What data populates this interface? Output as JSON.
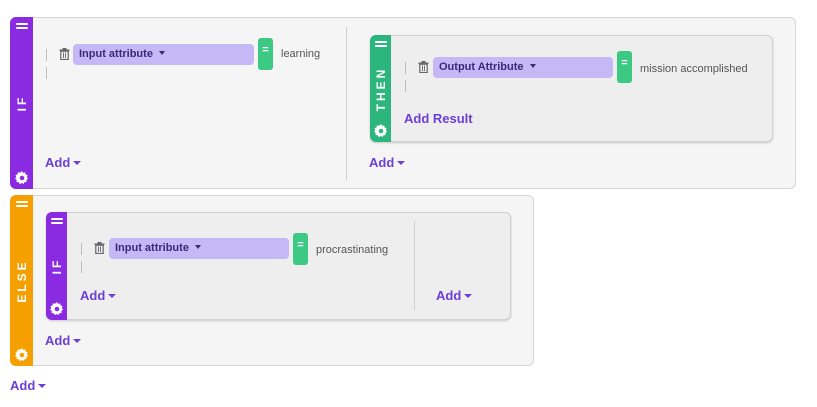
{
  "colors": {
    "if": "#8a2be2",
    "else": "#f5a000",
    "then": "#2db57e",
    "accent": "#6c3fd6",
    "equals": "#3cc984",
    "dropdown": "#c5b8f6"
  },
  "if_block": {
    "label": "IF",
    "condition": {
      "attribute": "Input attribute",
      "operator": "=",
      "value": "learning"
    },
    "add_label": "Add",
    "then_block": {
      "label": "THEN",
      "result": {
        "attribute": "Output Attribute",
        "operator": "=",
        "value": "mission accomplished"
      },
      "add_result_label": "Add Result"
    },
    "then_add_label": "Add"
  },
  "else_block": {
    "label": "ELSE",
    "nested_if": {
      "label": "IF",
      "condition": {
        "attribute": "Input attribute",
        "operator": "=",
        "value": "procrastinating"
      },
      "add_label": "Add",
      "then_add_label": "Add"
    },
    "add_label": "Add"
  },
  "root_add_label": "Add"
}
